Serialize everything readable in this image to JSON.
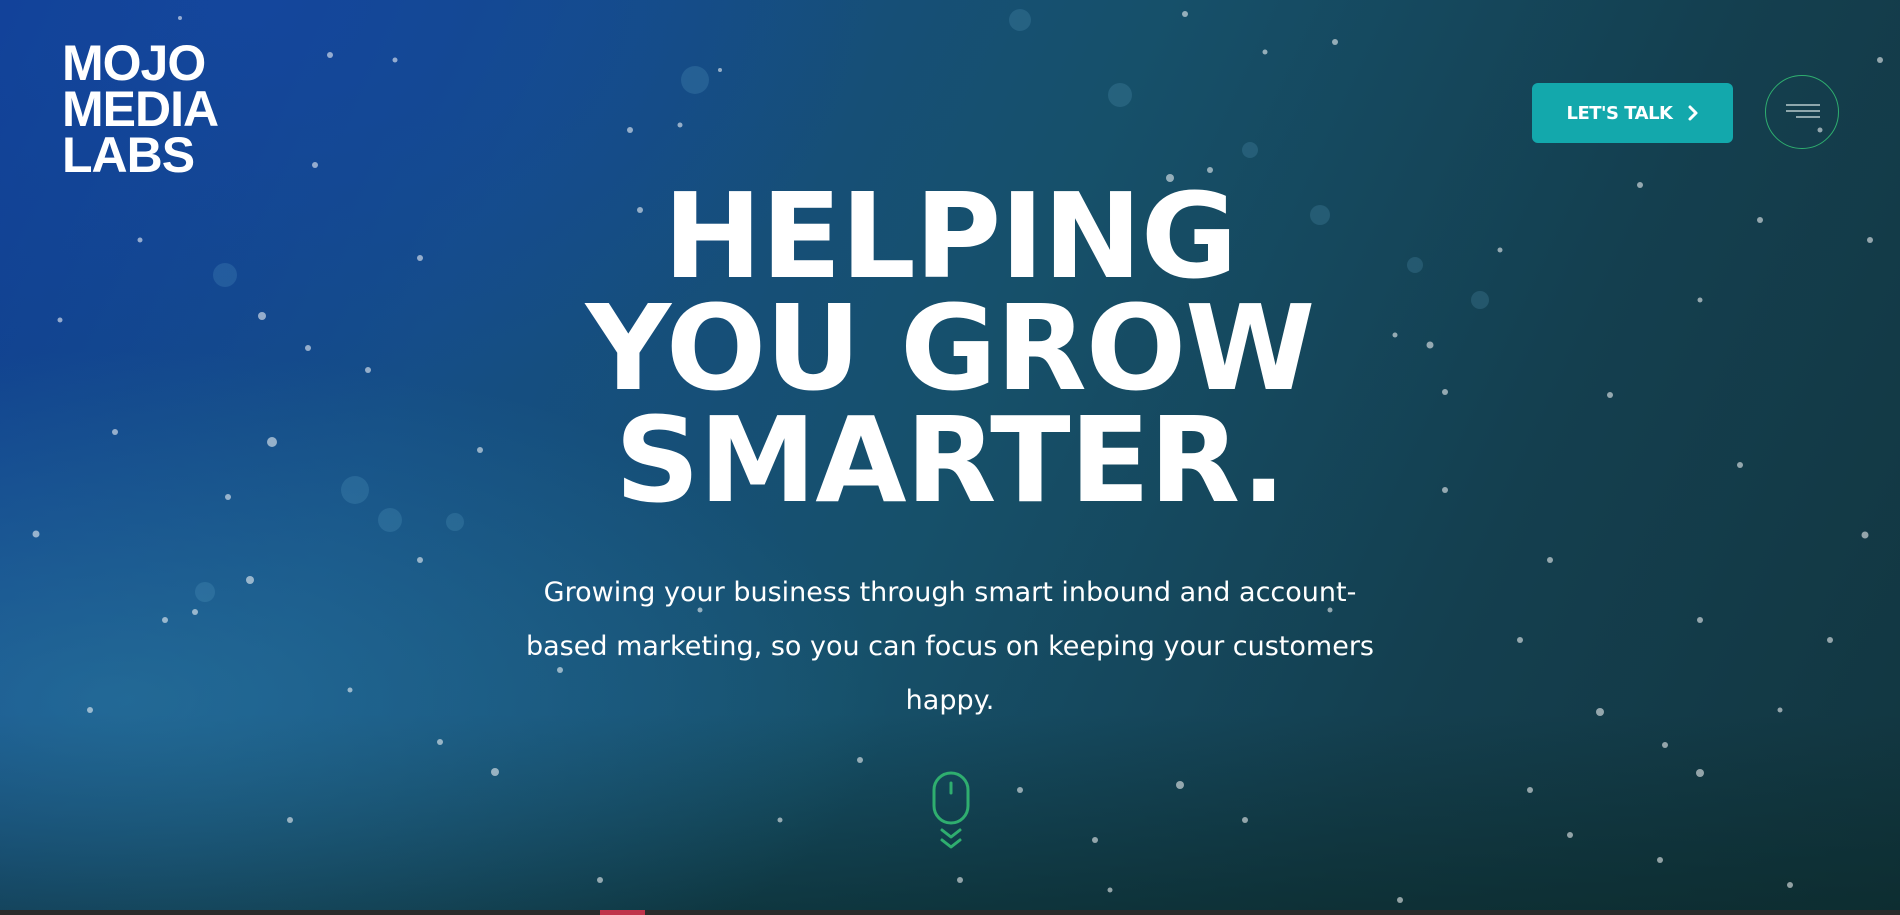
{
  "brand": {
    "logo_lines": [
      "MOJO",
      "MEDIA",
      "LABS"
    ]
  },
  "header": {
    "cta_label": "LET'S TALK",
    "cta_icon": "chevron-right-icon",
    "menu_icon": "hamburger-menu-icon"
  },
  "hero": {
    "headline_lines": [
      "HELPING",
      "YOU GROW",
      "SMARTER."
    ],
    "subtitle": "Growing your business through smart inbound and account-based marketing, so you can focus on keeping your customers happy.",
    "scroll_icon": "mouse-scroll-down-icon"
  },
  "colors": {
    "cta_bg": "#13a8ac",
    "accent_green": "#2fae6f",
    "bottom_accent": "#c0334a"
  }
}
